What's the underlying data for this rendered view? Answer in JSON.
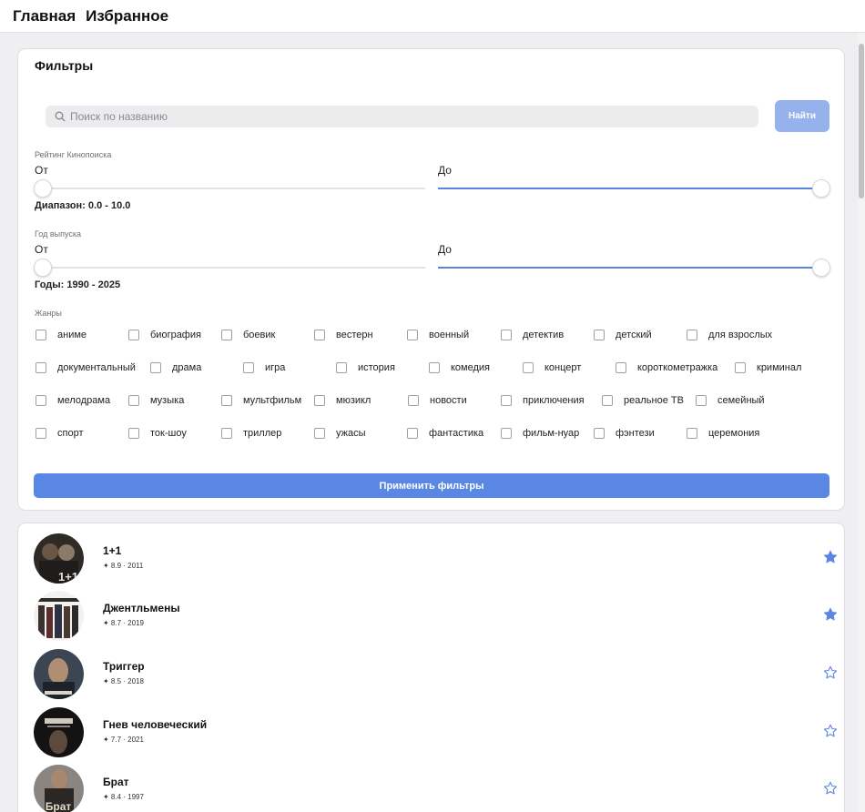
{
  "nav": {
    "home": "Главная",
    "favorites": "Избранное"
  },
  "filters": {
    "title": "Фильтры",
    "search_placeholder": "Поиск по названию",
    "find_button": "Найти",
    "rating": {
      "label": "Рейтинг Кинопоиска",
      "from_label": "От",
      "to_label": "До",
      "summary": "Диапазон: 0.0 - 10.0",
      "min": 0.0,
      "max": 10.0
    },
    "year": {
      "label": "Год выпуска",
      "from_label": "От",
      "to_label": "До",
      "summary": "Годы: 1990 - 2025",
      "min": 1990,
      "max": 2025
    },
    "genres_label": "Жанры",
    "genres": [
      "аниме",
      "биография",
      "боевик",
      "вестерн",
      "военный",
      "детектив",
      "детский",
      "для взрослых",
      "документальный",
      "драма",
      "игра",
      "история",
      "комедия",
      "концерт",
      "короткометражка",
      "криминал",
      "мелодрама",
      "музыка",
      "мультфильм",
      "мюзикл",
      "новости",
      "приключения",
      "реальное ТВ",
      "семейный",
      "спорт",
      "ток-шоу",
      "триллер",
      "ужасы",
      "фантастика",
      "фильм-нуар",
      "фэнтези",
      "церемония"
    ],
    "apply_button": "Применить фильтры"
  },
  "colors": {
    "accent": "#5a87e3",
    "accent_light": "#96b2ec"
  },
  "movies": [
    {
      "title": "1+1",
      "meta": "✦ 8.9 · 2011",
      "favorite": true,
      "poster_text": "1+1"
    },
    {
      "title": "Джентльмены",
      "meta": "✦ 8.7 · 2019",
      "favorite": true,
      "poster_text": ""
    },
    {
      "title": "Триггер",
      "meta": "✦ 8.5 · 2018",
      "favorite": false,
      "poster_text": ""
    },
    {
      "title": "Гнев человеческий",
      "meta": "✦ 7.7 · 2021",
      "favorite": false,
      "poster_text": ""
    },
    {
      "title": "Брат",
      "meta": "✦ 8.4 · 1997",
      "favorite": false,
      "poster_text": "Брат"
    }
  ]
}
